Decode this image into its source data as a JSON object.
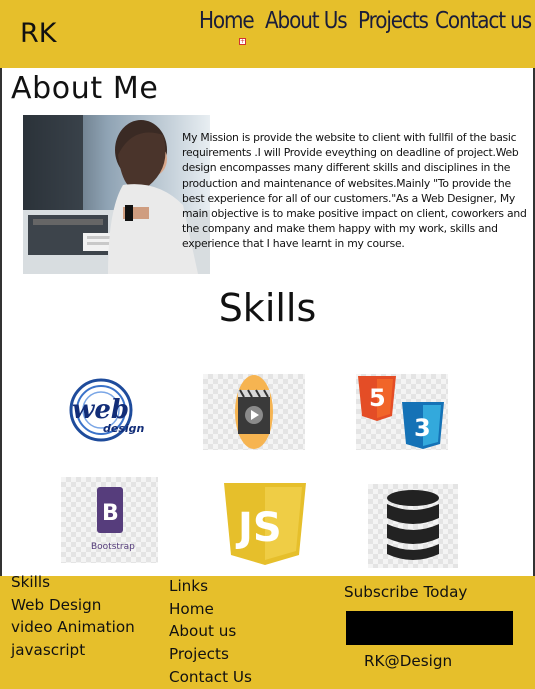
{
  "header": {
    "logo": "RK",
    "nav": [
      "Home",
      "About Us",
      "Projects",
      "Contact us"
    ]
  },
  "about": {
    "title": "About Me",
    "text": "My Mission is provide the website to client with fullfil of the basic requirements .I will Provide eveything on deadline of project.Web design encompasses many different skills and disciplines in the production and maintenance of websites.Mainly \"To provide the best experience for all of our customers.\"As a Web Designer, My main objective is to make positive impact on client, coworkers and the company and make them happy with my work, skills and experience that I have learnt in my course."
  },
  "skills": {
    "title": "Skills",
    "icons": [
      "web-design-logo",
      "video-clapperboard-icon",
      "html5-css3-icon",
      "bootstrap-icon",
      "javascript-icon",
      "database-icon"
    ],
    "web_logo_text": "web",
    "web_logo_sub": "design",
    "bootstrap_letter": "B",
    "bootstrap_label": "Bootstrap",
    "js_label": "JS",
    "html5_label": "5",
    "css3_label": "3"
  },
  "footer": {
    "skills_links": [
      "Skills",
      "Web Design",
      "video Animation",
      "javascript"
    ],
    "links": [
      "Links",
      "Home",
      "About us",
      "Projects",
      "Contact Us"
    ],
    "subscribe_title": "Subscribe Today",
    "subscribe_value": "",
    "credit": "RK@Design"
  },
  "colors": {
    "accent": "#e6bf2b",
    "nav_text": "#1a1d3a"
  }
}
